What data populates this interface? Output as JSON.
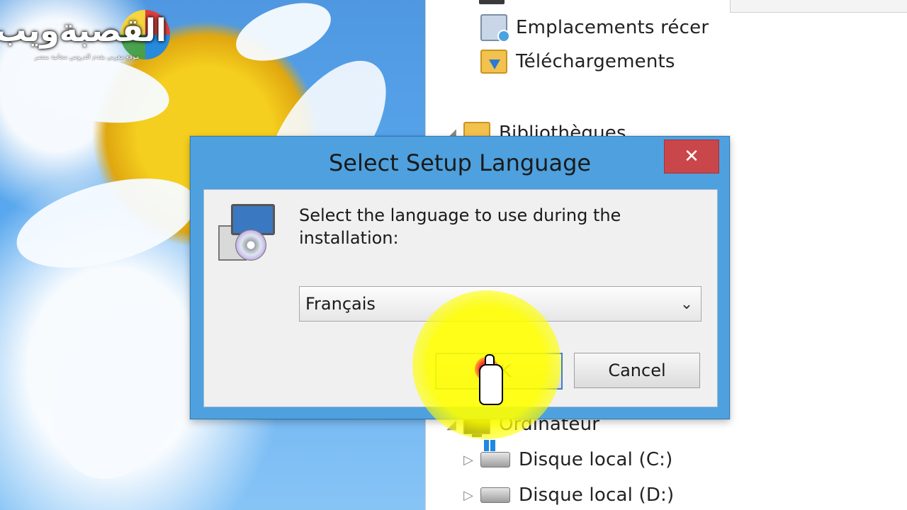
{
  "watermark": {
    "logo_text": "القصبةويب",
    "tagline": "موقع مغربي يقدم الدروس مجانية بمصر"
  },
  "explorer": {
    "items": [
      {
        "label": "Emplacements récer",
        "icon": "recent-places-icon"
      },
      {
        "label": "Téléchargements",
        "icon": "downloads-folder-icon"
      },
      {
        "label": "Bibliothèques",
        "icon": "libraries-folder-icon"
      },
      {
        "label": "Ordinateur",
        "icon": "computer-icon"
      },
      {
        "label": "Disque local (C:)",
        "icon": "local-disk-c-icon"
      },
      {
        "label": "Disque local (D:)",
        "icon": "local-disk-d-icon"
      }
    ]
  },
  "dialog": {
    "title": "Select Setup Language",
    "close_label": "✕",
    "prompt_line1": "Select the language to use during the",
    "prompt_line2": "installation:",
    "language_selected": "Français",
    "ok_label": "OK",
    "cancel_label": "Cancel"
  },
  "colors": {
    "dialog_frame": "#4ea1de",
    "close_button": "#c9464a",
    "highlight": "#ffff00",
    "click_dot": "#ff3b2f"
  }
}
